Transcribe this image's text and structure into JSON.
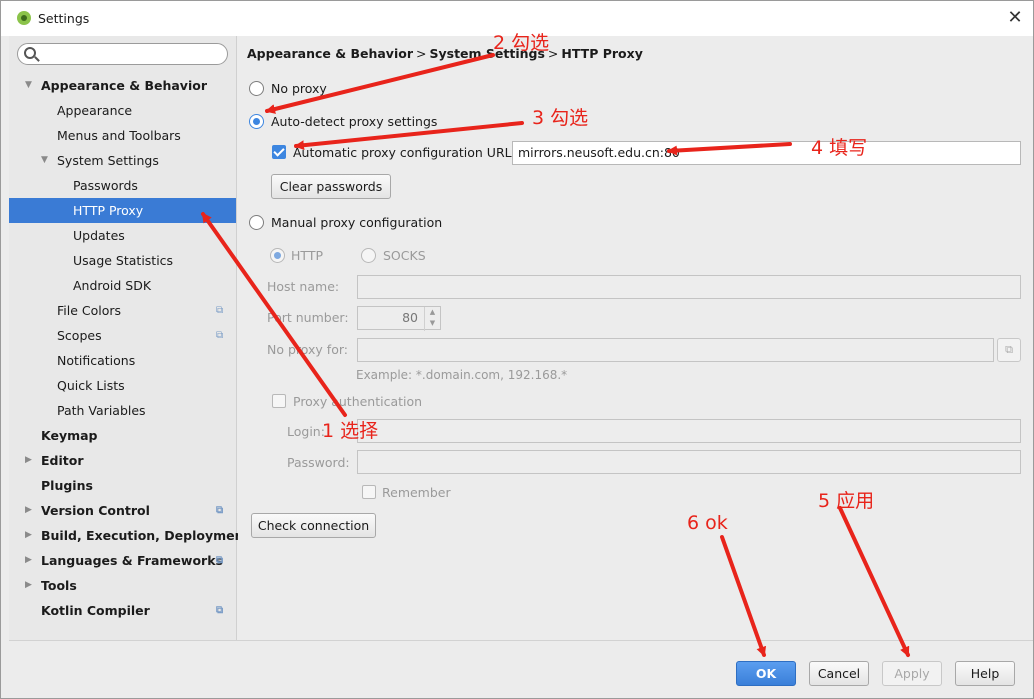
{
  "window": {
    "title": "Settings"
  },
  "sidebar": {
    "search_placeholder": "",
    "items": [
      {
        "label": "Appearance & Behavior",
        "bold": true,
        "level": 0,
        "arrow": "down"
      },
      {
        "label": "Appearance",
        "level": 1
      },
      {
        "label": "Menus and Toolbars",
        "level": 1
      },
      {
        "label": "System Settings",
        "level": 1,
        "arrow": "down"
      },
      {
        "label": "Passwords",
        "level": 2
      },
      {
        "label": "HTTP Proxy",
        "level": 2,
        "selected": true
      },
      {
        "label": "Updates",
        "level": 2
      },
      {
        "label": "Usage Statistics",
        "level": 2
      },
      {
        "label": "Android SDK",
        "level": 2
      },
      {
        "label": "File Colors",
        "level": 1,
        "gear": true
      },
      {
        "label": "Scopes",
        "level": 1,
        "gear": true
      },
      {
        "label": "Notifications",
        "level": 1
      },
      {
        "label": "Quick Lists",
        "level": 1
      },
      {
        "label": "Path Variables",
        "level": 1
      },
      {
        "label": "Keymap",
        "bold": true,
        "level": 0
      },
      {
        "label": "Editor",
        "bold": true,
        "level": 0,
        "arrow": "right"
      },
      {
        "label": "Plugins",
        "bold": true,
        "level": 0
      },
      {
        "label": "Version Control",
        "bold": true,
        "level": 0,
        "arrow": "right",
        "gear": true
      },
      {
        "label": "Build, Execution, Deployment",
        "bold": true,
        "level": 0,
        "arrow": "right"
      },
      {
        "label": "Languages & Frameworks",
        "bold": true,
        "level": 0,
        "arrow": "right",
        "gear": true
      },
      {
        "label": "Tools",
        "bold": true,
        "level": 0,
        "arrow": "right"
      },
      {
        "label": "Kotlin Compiler",
        "bold": true,
        "level": 0,
        "gear": true
      }
    ]
  },
  "breadcrumb": {
    "parts": [
      "Appearance & Behavior",
      "System Settings",
      "HTTP Proxy"
    ],
    "separator": ">"
  },
  "proxy": {
    "no_proxy_label": "No proxy",
    "auto_detect_label": "Auto-detect proxy settings",
    "auto_config_url_label": "Automatic proxy configuration URL:",
    "auto_config_url_value": "mirrors.neusoft.edu.cn:80",
    "clear_passwords_label": "Clear passwords",
    "manual_label": "Manual proxy configuration",
    "http_label": "HTTP",
    "socks_label": "SOCKS",
    "host_name_label": "Host name:",
    "host_name_value": "",
    "port_number_label": "Port number:",
    "port_number_value": "80",
    "no_proxy_for_label": "No proxy for:",
    "no_proxy_for_value": "",
    "example_text": "Example: *.domain.com, 192.168.*",
    "proxy_auth_label": "Proxy authentication",
    "login_label": "Login:",
    "password_label": "Password:",
    "remember_label": "Remember",
    "check_connection_label": "Check connection"
  },
  "footer": {
    "ok_label": "OK",
    "cancel_label": "Cancel",
    "apply_label": "Apply",
    "help_label": "Help"
  },
  "annotations": {
    "step1": "1 选择",
    "step2": "2 勾选",
    "step3": "3 勾选",
    "step4": "4 填写",
    "step5": "5 应用",
    "step6": "6 ok"
  },
  "colors": {
    "accent": "#3a7bd5",
    "annotation": "#e8241b"
  }
}
